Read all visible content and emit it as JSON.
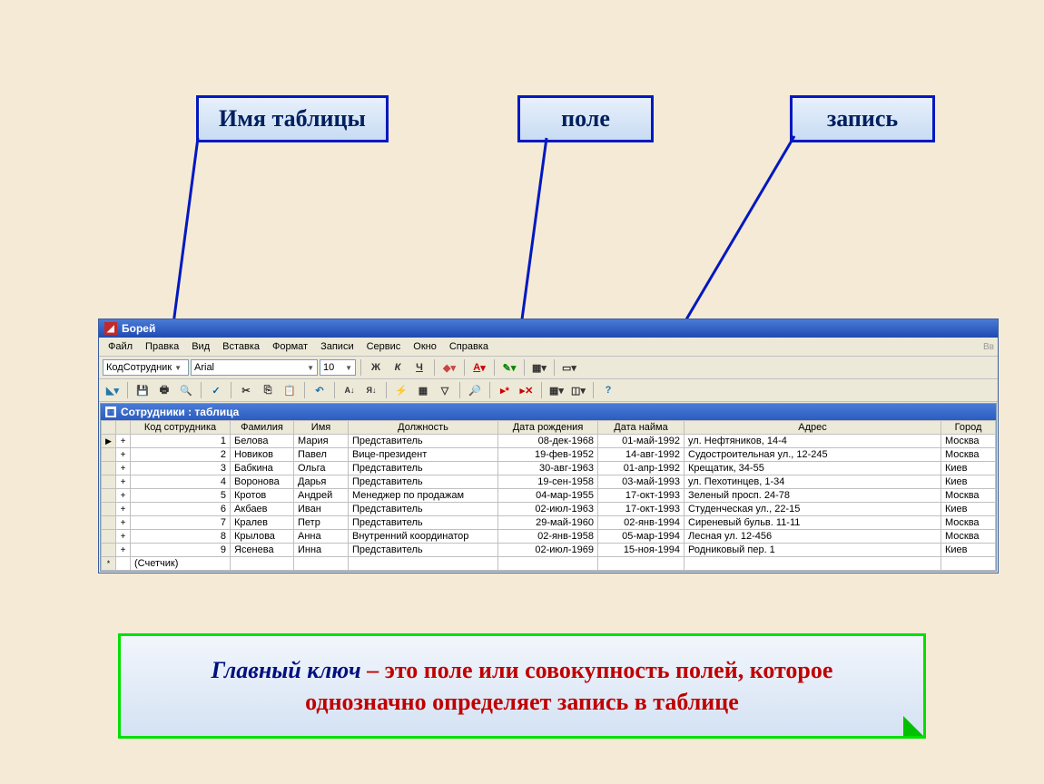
{
  "labels": {
    "l1": "Имя таблицы",
    "l2": "поле",
    "l3": "запись"
  },
  "window": {
    "title": "Борей",
    "menus": [
      "Файл",
      "Правка",
      "Вид",
      "Вставка",
      "Формат",
      "Записи",
      "Сервис",
      "Окно",
      "Справка"
    ],
    "field_selector": "КодСотрудник",
    "font_name": "Arial",
    "font_size": "10",
    "table_title": "Сотрудники : таблица"
  },
  "columns": [
    "Код сотрудника",
    "Фамилия",
    "Имя",
    "Должность",
    "Дата рождения",
    "Дата найма",
    "Адрес",
    "Город"
  ],
  "rows": [
    {
      "id": "1",
      "fam": "Белова",
      "name": "Мария",
      "pos": "Представитель",
      "bd": "08-дек-1968",
      "hd": "01-май-1992",
      "addr": "ул. Нефтяников, 14-4",
      "city": "Москва"
    },
    {
      "id": "2",
      "fam": "Новиков",
      "name": "Павел",
      "pos": "Вице-президент",
      "bd": "19-фев-1952",
      "hd": "14-авг-1992",
      "addr": "Судостроительная ул., 12-245",
      "city": "Москва"
    },
    {
      "id": "3",
      "fam": "Бабкина",
      "name": "Ольга",
      "pos": "Представитель",
      "bd": "30-авг-1963",
      "hd": "01-апр-1992",
      "addr": "Крещатик, 34-55",
      "city": "Киев"
    },
    {
      "id": "4",
      "fam": "Воронова",
      "name": "Дарья",
      "pos": "Представитель",
      "bd": "19-сен-1958",
      "hd": "03-май-1993",
      "addr": "ул. Пехотинцев, 1-34",
      "city": "Киев"
    },
    {
      "id": "5",
      "fam": "Кротов",
      "name": "Андрей",
      "pos": "Менеджер по продажам",
      "bd": "04-мар-1955",
      "hd": "17-окт-1993",
      "addr": "Зеленый просп. 24-78",
      "city": "Москва"
    },
    {
      "id": "6",
      "fam": "Акбаев",
      "name": "Иван",
      "pos": "Представитель",
      "bd": "02-июл-1963",
      "hd": "17-окт-1993",
      "addr": "Студенческая ул., 22-15",
      "city": "Киев"
    },
    {
      "id": "7",
      "fam": "Кралев",
      "name": "Петр",
      "pos": "Представитель",
      "bd": "29-май-1960",
      "hd": "02-янв-1994",
      "addr": "Сиреневый бульв. 11-11",
      "city": "Москва"
    },
    {
      "id": "8",
      "fam": "Крылова",
      "name": "Анна",
      "pos": "Внутренний координатор",
      "bd": "02-янв-1958",
      "hd": "05-мар-1994",
      "addr": "Лесная ул. 12-456",
      "city": "Москва"
    },
    {
      "id": "9",
      "fam": "Ясенева",
      "name": "Инна",
      "pos": "Представитель",
      "bd": "02-июл-1969",
      "hd": "15-ноя-1994",
      "addr": "Родниковый пер. 1",
      "city": "Киев"
    }
  ],
  "counter": "(Счетчик)",
  "definition": {
    "key": "Главный ключ",
    "rest": " – это поле или совокупность полей, которое однозначно определяет запись в таблице"
  }
}
